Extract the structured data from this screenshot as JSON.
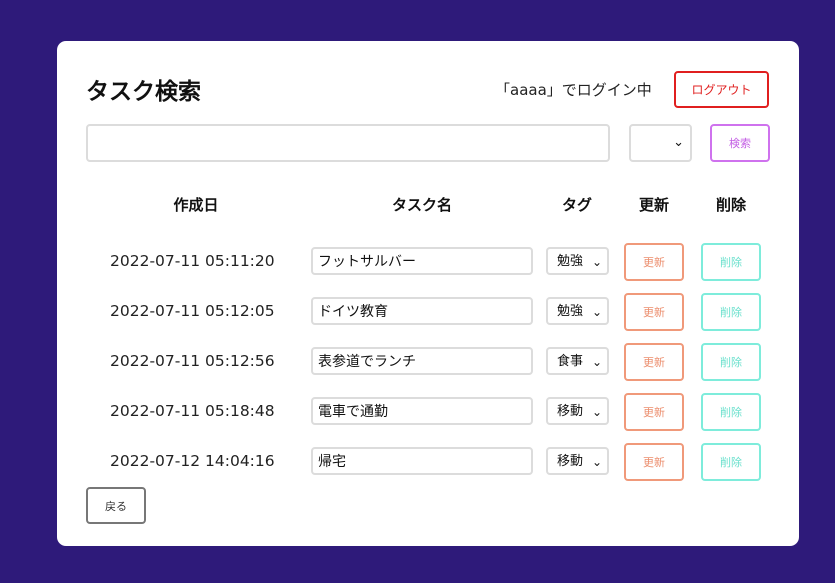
{
  "header": {
    "title": "タスク検索",
    "login_status": "「aaaa」でログイン中",
    "logout_label": "ログアウト"
  },
  "search": {
    "query_value": "",
    "tag_value": "",
    "button_label": "検索"
  },
  "table": {
    "columns": [
      "作成日",
      "タスク名",
      "タグ",
      "更新",
      "削除"
    ],
    "rows": [
      {
        "created": "2022-07-11 05:11:20",
        "name": "フットサルバー",
        "tag": "勉強",
        "update_label": "更新",
        "delete_label": "削除"
      },
      {
        "created": "2022-07-11 05:12:05",
        "name": "ドイツ教育",
        "tag": "勉強",
        "update_label": "更新",
        "delete_label": "削除"
      },
      {
        "created": "2022-07-11 05:12:56",
        "name": "表参道でランチ",
        "tag": "食事",
        "update_label": "更新",
        "delete_label": "削除"
      },
      {
        "created": "2022-07-11 05:18:48",
        "name": "電車で通勤",
        "tag": "移動",
        "update_label": "更新",
        "delete_label": "削除"
      },
      {
        "created": "2022-07-12 14:04:16",
        "name": "帰宅",
        "tag": "移動",
        "update_label": "更新",
        "delete_label": "削除"
      }
    ]
  },
  "footer": {
    "back_label": "戻る"
  },
  "colors": {
    "background": "#2e1a7a",
    "logout": "#e01f1f",
    "search_button": "#cf72ee",
    "update_button": "#f0997a",
    "delete_button": "#7eecdb",
    "back_button": "#777777"
  },
  "icons": {
    "select_arrow": "chevron-down-icon"
  }
}
